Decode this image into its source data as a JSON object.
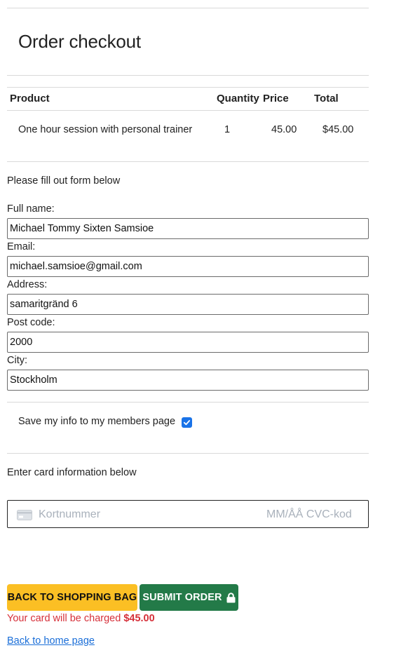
{
  "page": {
    "title": "Order checkout"
  },
  "table": {
    "headers": {
      "product": "Product",
      "quantity": "Quantity",
      "price": "Price",
      "total": "Total"
    },
    "rows": [
      {
        "product": "One hour session with personal trainer",
        "quantity": "1",
        "price": "45.00",
        "total": "$45.00"
      }
    ]
  },
  "form": {
    "intro": "Please fill out form below",
    "full_name": {
      "label": "Full name:",
      "value": "Michael Tommy Sixten Samsioe"
    },
    "email": {
      "label": "Email:",
      "value": "michael.samsioe@gmail.com"
    },
    "address": {
      "label": "Address:",
      "value": "samaritgränd 6"
    },
    "post_code": {
      "label": "Post code:",
      "value": "2000"
    },
    "city": {
      "label": "City:",
      "value": "Stockholm"
    },
    "save_info": {
      "label": "Save my info to my members page",
      "checked": true
    }
  },
  "card": {
    "intro": "Enter card information below",
    "number_placeholder": "Kortnummer",
    "expiry_cvc_placeholder": "MM/ÅÅ CVC-kod",
    "icon": "credit-card-icon"
  },
  "actions": {
    "back_label": "BACK TO SHOPPING BAG",
    "submit_label": "SUBMIT ORDER",
    "submit_icon": "lock-icon",
    "charge_prefix": "Your card will be charged",
    "charge_amount": "$45.00",
    "home_link": "Back to home page"
  },
  "colors": {
    "back_button": "#fbbf24",
    "submit_button": "#237a48",
    "charge_text": "#d6303a",
    "link": "#1a6ed8",
    "checkbox": "#1a73e8"
  }
}
